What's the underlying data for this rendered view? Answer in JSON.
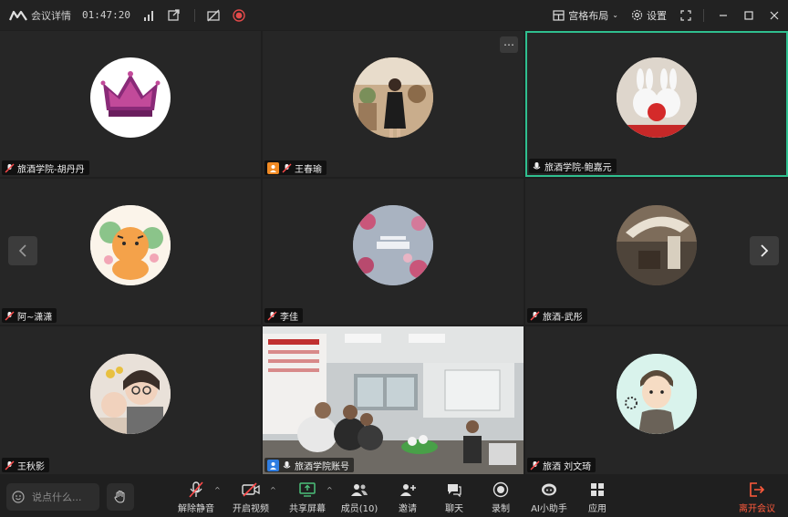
{
  "topbar": {
    "meeting_details": "会议详情",
    "elapsed": "01:47:20",
    "layout_label": "宫格布局",
    "settings_label": "设置"
  },
  "participants": [
    {
      "name": "旅酒学院-胡丹丹",
      "muted": true
    },
    {
      "name": "王春瑜",
      "muted": true,
      "host": true
    },
    {
      "name": "旅酒学院-鲍嘉元",
      "muted": false,
      "active": true
    },
    {
      "name": "阿~潇潇",
      "muted": true
    },
    {
      "name": "李佳",
      "muted": true
    },
    {
      "name": "旅酒-武彤",
      "muted": true
    },
    {
      "name": "王秋影",
      "muted": true
    },
    {
      "name": "旅酒学院账号",
      "muted": false,
      "host": true,
      "video": true
    },
    {
      "name": "旅酒 刘文琦",
      "muted": true
    }
  ],
  "bottombar": {
    "chat_placeholder": "说点什么...",
    "tools": {
      "unmute": "解除静音",
      "video": "开启视频",
      "share": "共享屏幕",
      "members": "成员(10)",
      "invite": "邀请",
      "chat": "聊天",
      "record": "录制",
      "ai": "AI小助手",
      "apps": "应用",
      "leave": "离开会议"
    }
  },
  "colors": {
    "active_border": "#2fbf8f",
    "host_badge": "#f08a24",
    "leave": "#ff5a3c"
  }
}
